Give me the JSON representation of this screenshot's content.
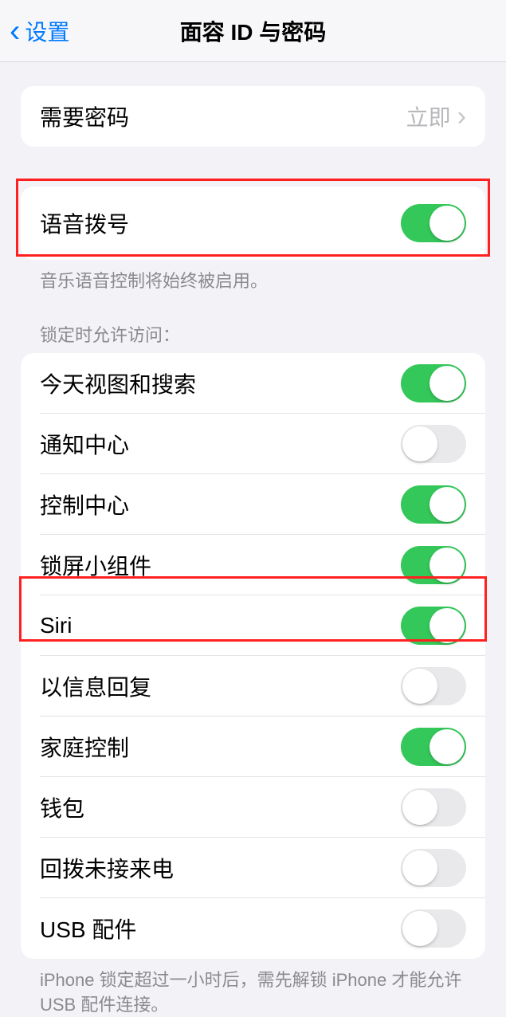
{
  "header": {
    "back_label": "设置",
    "title": "面容 ID 与密码"
  },
  "require_passcode": {
    "label": "需要密码",
    "value": "立即"
  },
  "voice_dial": {
    "label": "语音拨号",
    "footer": "音乐语音控制将始终被启用。"
  },
  "lock_section_header": "锁定时允许访问：",
  "lock_items": [
    {
      "label": "今天视图和搜索",
      "on": true
    },
    {
      "label": "通知中心",
      "on": false
    },
    {
      "label": "控制中心",
      "on": true
    },
    {
      "label": "锁屏小组件",
      "on": true
    },
    {
      "label": "Siri",
      "on": true
    },
    {
      "label": "以信息回复",
      "on": false
    },
    {
      "label": "家庭控制",
      "on": true
    },
    {
      "label": "钱包",
      "on": false
    },
    {
      "label": "回拨未接来电",
      "on": false
    },
    {
      "label": "USB 配件",
      "on": false
    }
  ],
  "usb_footer": "iPhone 锁定超过一小时后，需先解锁 iPhone 才能允许USB 配件连接。"
}
